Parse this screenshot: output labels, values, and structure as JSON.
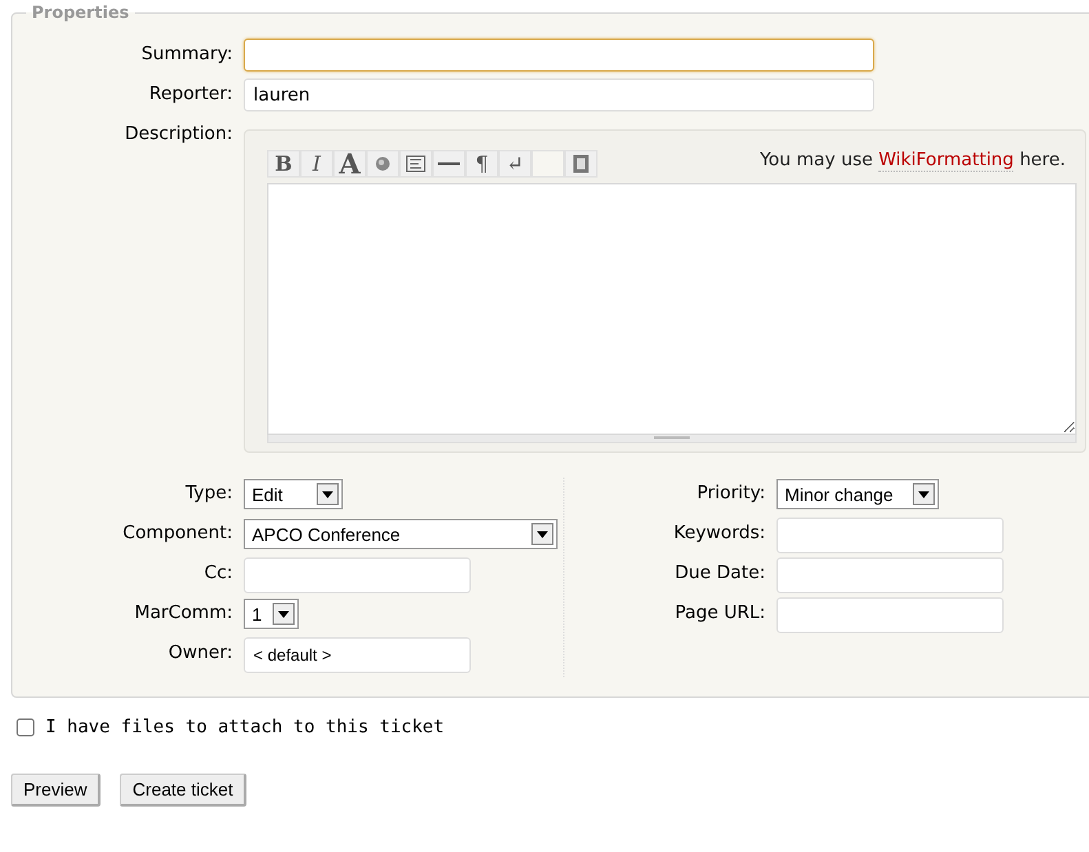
{
  "properties": {
    "legend": "Properties",
    "summary": {
      "label": "Summary:",
      "focused": true
    },
    "reporter": {
      "label": "Reporter:",
      "value": "lauren",
      "focused": false
    },
    "description": {
      "label": "Description:",
      "hint_before": "You may use ",
      "hint_link": "WikiFormatting",
      "hint_after": " here.",
      "toolbar": [
        {
          "kind": "bold",
          "text": "B"
        },
        {
          "kind": "italic",
          "text": "I"
        },
        {
          "kind": "big",
          "text": "A"
        },
        {
          "kind": "globe"
        },
        {
          "kind": "block"
        },
        {
          "kind": "rule"
        },
        {
          "kind": "plain",
          "text": "¶"
        },
        {
          "kind": "plain",
          "text": "↵"
        },
        {
          "kind": "blank"
        },
        {
          "kind": "macro"
        }
      ]
    },
    "left_fields": [
      {
        "kind": "select",
        "label": "Type:",
        "value": "Edit"
      },
      {
        "kind": "select",
        "label": "Component:",
        "value": "APCO Conference"
      },
      {
        "kind": "text",
        "label": "Cc:"
      },
      {
        "kind": "select",
        "label": "MarComm:",
        "value": "1"
      },
      {
        "kind": "text",
        "label": "Owner:",
        "value": "< default >"
      }
    ],
    "right_fields": [
      {
        "kind": "select",
        "label": "Priority:",
        "value": "Minor change"
      },
      {
        "kind": "text",
        "label": "Keywords:"
      },
      {
        "kind": "text",
        "label": "Due Date:"
      },
      {
        "kind": "text",
        "label": "Page URL:"
      }
    ]
  },
  "attach": {
    "label": "I have files to attach to this ticket",
    "checked": false
  },
  "buttons": [
    "Preview",
    "Create ticket"
  ]
}
